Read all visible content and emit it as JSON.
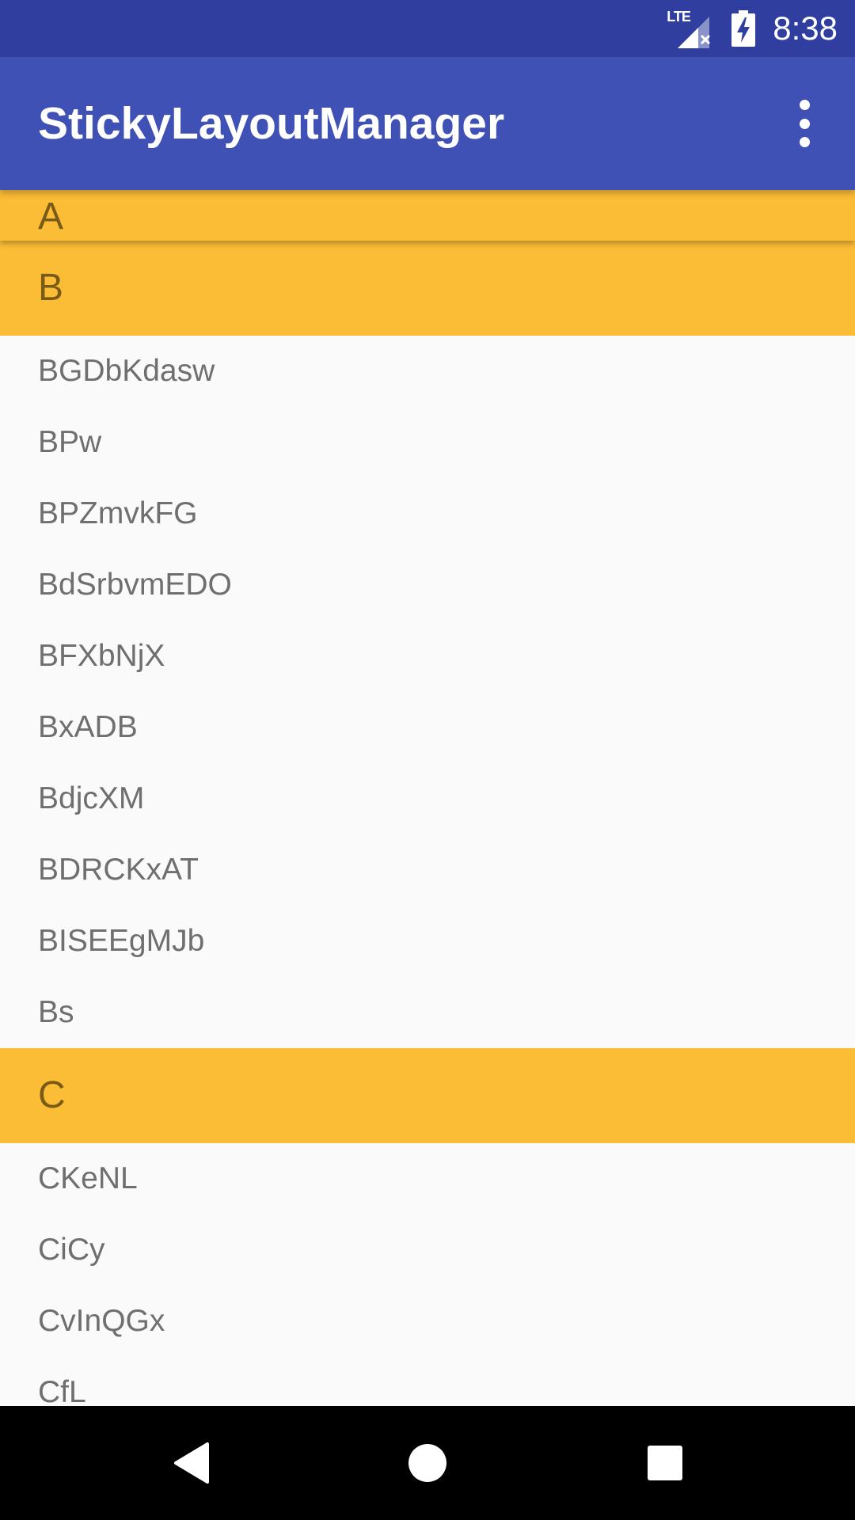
{
  "status_bar": {
    "network_label": "LTE",
    "time": "8:38"
  },
  "app_bar": {
    "title": "StickyLayoutManager"
  },
  "sticky_header": {
    "label": "A"
  },
  "sections": [
    {
      "header": "B",
      "items": [
        "BGDbKdasw",
        "BPw",
        "BPZmvkFG",
        "BdSrbvmEDO",
        "BFXbNjX",
        "BxADB",
        "BdjcXM",
        "BDRCKxAT",
        "BISEEgMJb",
        "Bs"
      ]
    },
    {
      "header": "C",
      "items": [
        "CKeNL",
        "CiCy",
        "CvInQGx",
        "CfL"
      ]
    }
  ],
  "colors": {
    "status_bar": "#303f9f",
    "app_bar": "#3f51b5",
    "section_header": "#fbbc36",
    "header_text": "#7a5a17",
    "item_text": "#6f6f6f",
    "list_background": "#fafafa",
    "nav_bar": "#000000"
  },
  "icons": {
    "signal": "signal-icon",
    "battery": "battery-charging-icon",
    "overflow": "more-vert-icon",
    "back": "back-icon",
    "home": "home-icon",
    "recents": "recents-icon"
  }
}
